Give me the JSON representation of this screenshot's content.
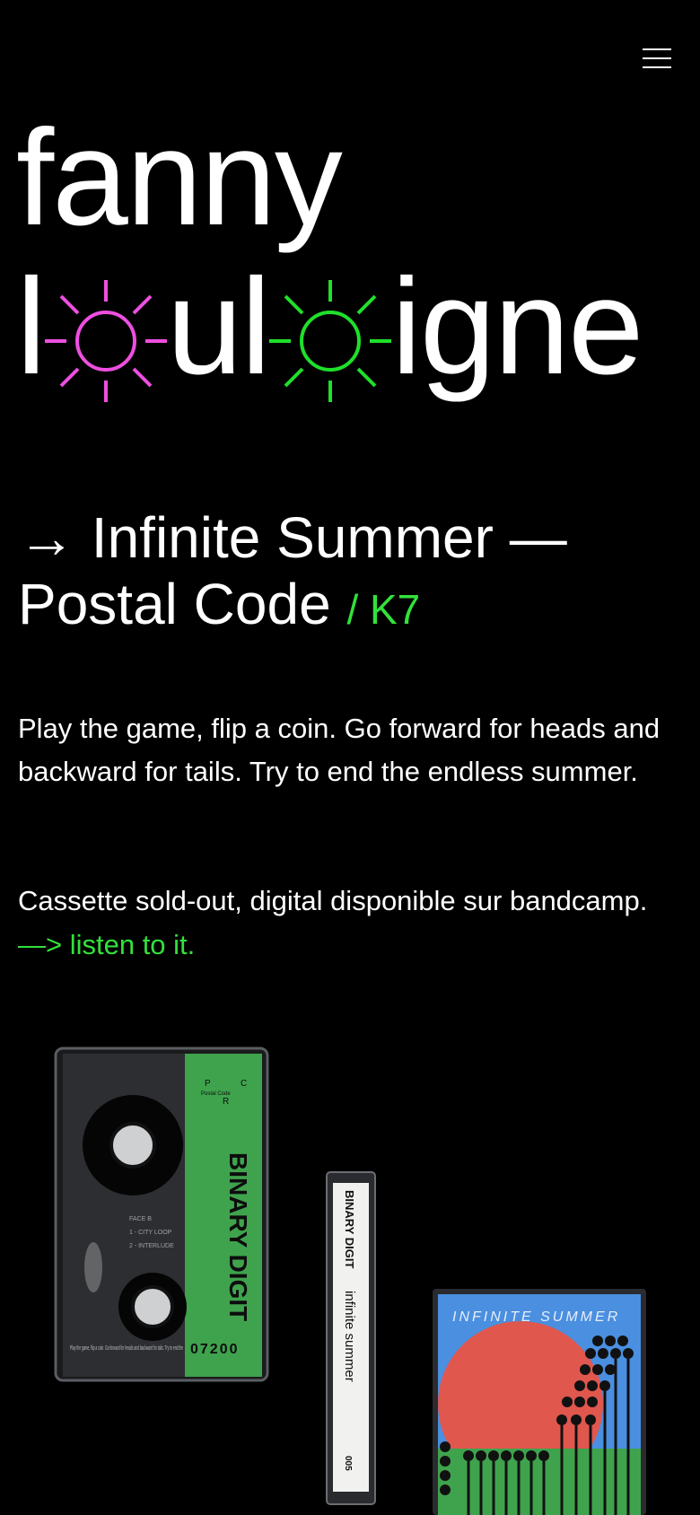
{
  "header": {
    "menu_icon": "hamburger-menu-icon"
  },
  "artist": {
    "line1": "fanny",
    "line2_part1": "l",
    "line2_part2": "ul",
    "line2_part3": "igne",
    "sun_icons": [
      "sun-icon",
      "sun-icon"
    ],
    "sun_colors": [
      "#ee4fe0",
      "#1fe02a"
    ]
  },
  "release": {
    "title": "→ Infinite Summer — Postal Code",
    "format": "/ K7"
  },
  "description": "Play the game, flip a coin. Go forward for heads and backward for tails. Try to end the endless summer.",
  "availability": "Cassette sold-out, digital disponible sur bandcamp.",
  "listen_link": "—> listen to it.",
  "products": {
    "cassette": {
      "label_title": "BINARY DIGIT",
      "catalog": "07200",
      "face": "FACE B",
      "tracks": [
        "1 - CITY LOOP",
        "2 - INTERLUDE"
      ],
      "label_text": "Play the game, flip a coin. Go forward for heads and backward for tails. Try to end the",
      "logo_top": "Postal Code",
      "logo_letters": [
        "P",
        "C",
        "R"
      ]
    },
    "spine": {
      "artist": "BINARY DIGIT",
      "title": "infinite summer",
      "code": "005"
    },
    "jcard": {
      "title": "INFINITE  SUMMER"
    }
  },
  "colors": {
    "background": "#000000",
    "text": "#ffffff",
    "accent_green": "#33e13a",
    "accent_pink": "#ee4fe0",
    "cassette_label_green": "#3fa34d",
    "jcard_blue": "#4a8fe0",
    "jcard_red": "#e0574e"
  }
}
